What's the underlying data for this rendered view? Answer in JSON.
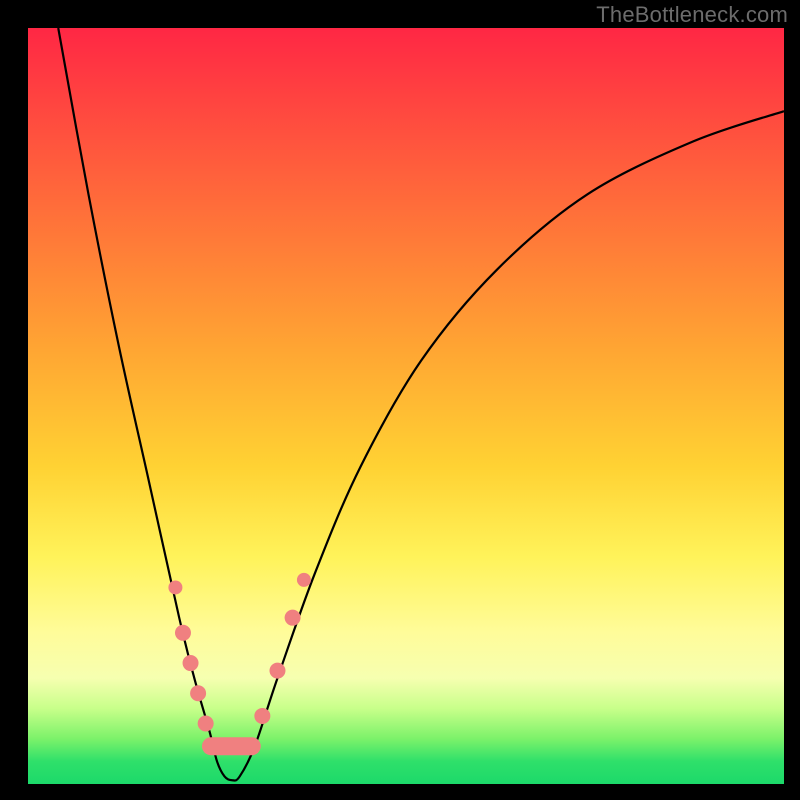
{
  "watermark": "TheBottleneck.com",
  "chart_data": {
    "type": "line",
    "title": "",
    "xlabel": "",
    "ylabel": "",
    "xlim": [
      0,
      100
    ],
    "ylim": [
      0,
      100
    ],
    "grid": false,
    "series": [
      {
        "name": "bottleneck-curve",
        "x": [
          4,
          8,
          12,
          16,
          20,
          22,
          24,
          25,
          26,
          27,
          28,
          30,
          33,
          38,
          44,
          52,
          62,
          74,
          88,
          100
        ],
        "y": [
          100,
          78,
          58,
          40,
          22,
          14,
          7,
          3,
          1,
          0.5,
          1,
          5,
          14,
          28,
          42,
          56,
          68,
          78,
          85,
          89
        ]
      }
    ],
    "markers": {
      "name": "highlighted-points",
      "color": "#f08080",
      "x": [
        20.5,
        21.5,
        22.5,
        23.5,
        24.2,
        25.0,
        25.8,
        26.6,
        27.4,
        28.4,
        29.6,
        31.0,
        33.0,
        35.0
      ],
      "y": [
        20,
        16,
        12,
        8,
        5,
        2.5,
        1,
        0.5,
        1,
        2.5,
        5,
        9,
        15,
        22
      ]
    },
    "gradient_bands": {
      "description": "vertical bottleneck color scale",
      "stops": [
        {
          "pos": 0.0,
          "color": "#ff2744"
        },
        {
          "pos": 0.28,
          "color": "#ff7a38"
        },
        {
          "pos": 0.58,
          "color": "#ffd233"
        },
        {
          "pos": 0.8,
          "color": "#fffc9a"
        },
        {
          "pos": 0.94,
          "color": "#7cf26a"
        },
        {
          "pos": 1.0,
          "color": "#1cd96a"
        }
      ]
    }
  }
}
